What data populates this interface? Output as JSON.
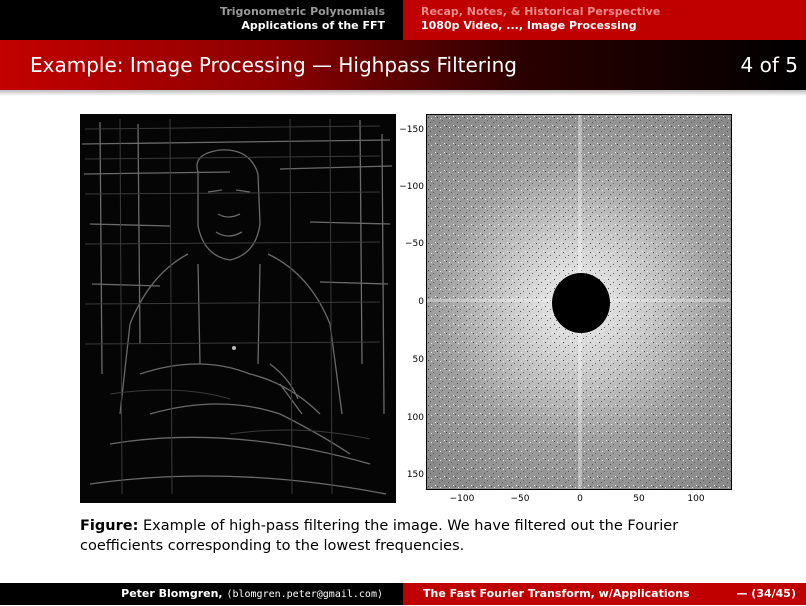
{
  "nav": {
    "left_line1": "Trigonometric Polynomials",
    "left_line2": "Applications of the FFT",
    "right_line1": "Recap, Notes, & Historical Perspective",
    "right_line2": "1080p Video, ..., Image Processing"
  },
  "slide": {
    "title": "Example: Image Processing — Highpass Filtering",
    "counter": "4 of 5"
  },
  "figure": {
    "y_ticks": [
      "−150",
      "−100",
      "−50",
      "0",
      "50",
      "100",
      "150"
    ],
    "x_ticks": [
      "−100",
      "−50",
      "0",
      "50",
      "100"
    ],
    "caption_label": "Figure:",
    "caption_text": "Example of high-pass filtering the image. We have filtered out the Fourier coefficients corresponding to the lowest frequencies."
  },
  "footer": {
    "author": "Peter Blomgren,",
    "email": "⟨blomgren.peter@gmail.com⟩",
    "course": "The Fast Fourier Transform, w/Applications",
    "page": "— (34/45)"
  }
}
